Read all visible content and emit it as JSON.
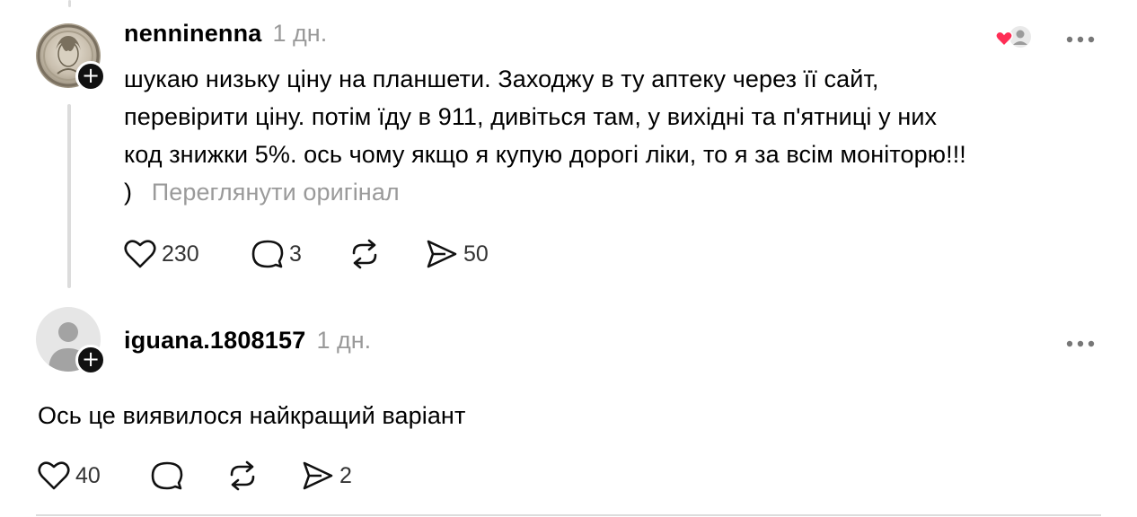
{
  "comments": [
    {
      "username": "nenninenna",
      "time": "1 дн.",
      "text_lines": [
        "шукаю низьку ціну на планшети. Заходжу в ту аптеку через її сайт,",
        "перевірити ціну. потім їду в 911, дивіться там, у вихідні та п'ятниці у них",
        "код знижки 5%. ось чому якщо я купую дорогі ліки, то я за всім моніторю!!!",
        ")"
      ],
      "view_original": "Переглянути оригінал",
      "likes": "230",
      "replies": "3",
      "shares": "50"
    },
    {
      "username": "iguana.1808157",
      "time": "1 дн.",
      "text": "Ось це виявилося найкращий варіант",
      "likes": "40",
      "shares": "2"
    }
  ],
  "icons": {
    "like": "heart-icon",
    "reply": "speech-bubble-icon",
    "repost": "repost-icon",
    "share": "send-icon",
    "more": "more-dots-icon",
    "liked_by": "liked-by-avatar-icon"
  },
  "colors": {
    "like_badge": "#ff2d55",
    "muted": "#9a9a9a"
  }
}
